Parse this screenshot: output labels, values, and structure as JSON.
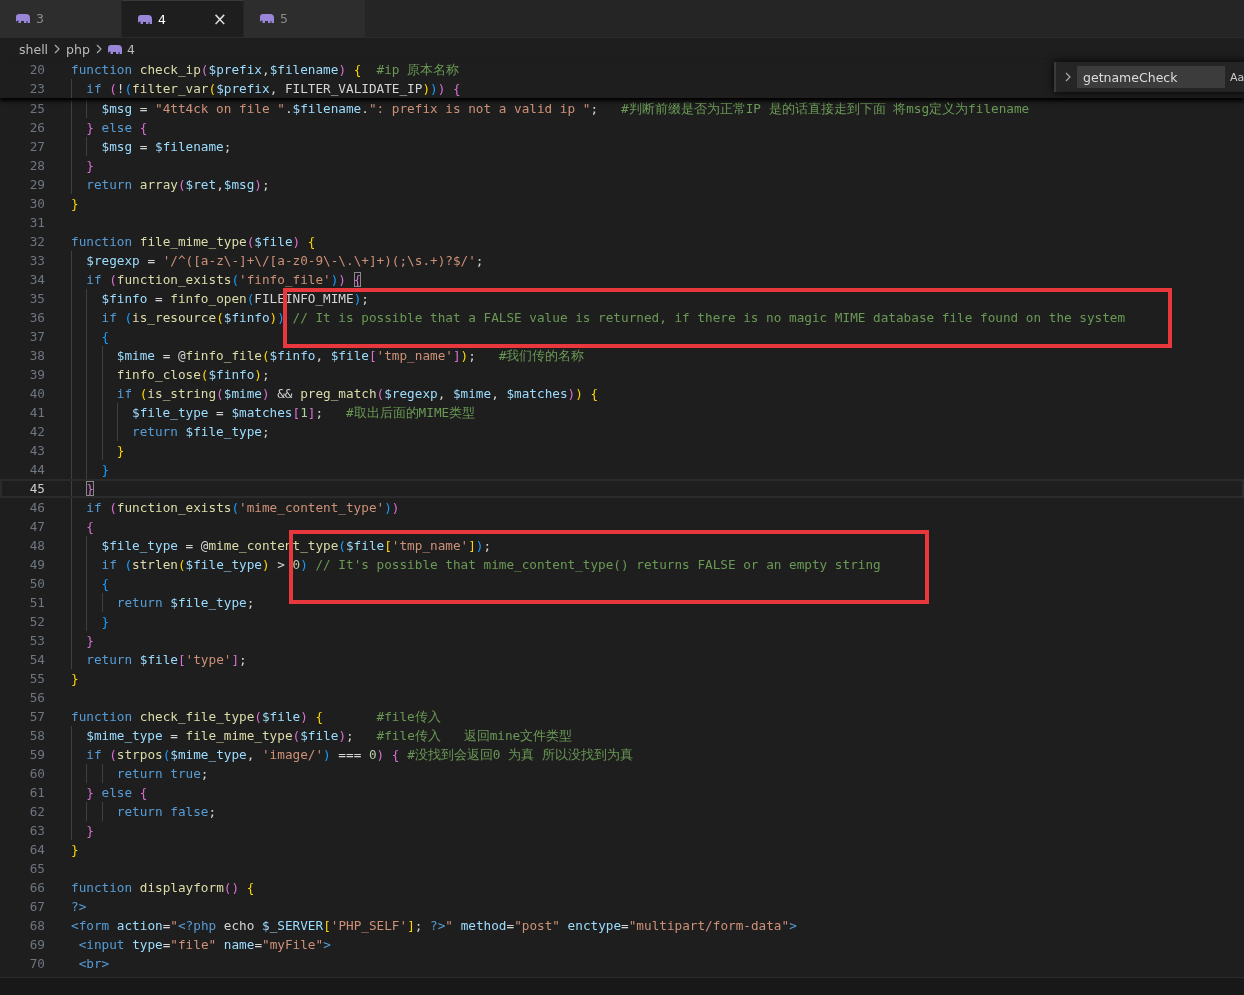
{
  "tabs": [
    {
      "label": "3",
      "selected": false,
      "closable": false
    },
    {
      "label": "4",
      "selected": true,
      "closable": true
    },
    {
      "label": "5",
      "selected": false,
      "closable": false
    }
  ],
  "close_glyph": "×",
  "breadcrumb": [
    "shell",
    "php",
    "4"
  ],
  "find": {
    "value": "getnameCheck",
    "toggle": "Aa"
  },
  "sticky_lines": [
    {
      "n": "20",
      "current": false,
      "tokens": [
        {
          "kind": "kw",
          "text": "function "
        },
        {
          "kind": "fn",
          "text": "check_ip"
        },
        {
          "kind": "b2",
          "text": "("
        },
        {
          "kind": "var",
          "text": "$prefix"
        },
        {
          "kind": "op",
          "text": ","
        },
        {
          "kind": "var",
          "text": "$filename"
        },
        {
          "kind": "b2",
          "text": ") "
        },
        {
          "kind": "b1",
          "text": "{  "
        },
        {
          "kind": "cm",
          "text": "#ip 原本名称"
        }
      ]
    },
    {
      "n": "23",
      "current": false,
      "tokens": [
        {
          "kind": "kw",
          "text": "  if "
        },
        {
          "kind": "b2",
          "text": "("
        },
        {
          "kind": "op",
          "text": "!"
        },
        {
          "kind": "b3",
          "text": "("
        },
        {
          "kind": "fn",
          "text": "filter_var"
        },
        {
          "kind": "b1",
          "text": "("
        },
        {
          "kind": "var",
          "text": "$prefix"
        },
        {
          "kind": "op",
          "text": ", FILTER_VALIDATE_IP"
        },
        {
          "kind": "b1",
          "text": ")"
        },
        {
          "kind": "b3",
          "text": ")"
        },
        {
          "kind": "b2",
          "text": ") {"
        }
      ]
    }
  ],
  "lines": [
    {
      "n": "25",
      "current": false,
      "tokens": [
        {
          "kind": "var",
          "text": "    $msg"
        },
        {
          "kind": "op",
          "text": " = "
        },
        {
          "kind": "str",
          "text": "\"4tt4ck on file \""
        },
        {
          "kind": "op",
          "text": "."
        },
        {
          "kind": "var",
          "text": "$filename"
        },
        {
          "kind": "op",
          "text": "."
        },
        {
          "kind": "str",
          "text": "\": prefix is not a valid ip \""
        },
        {
          "kind": "op",
          "text": ";   "
        },
        {
          "kind": "cm",
          "text": "#判断前缀是否为正常IP 是的话直接走到下面 将msg定义为filename"
        }
      ]
    },
    {
      "n": "26",
      "current": false,
      "tokens": [
        {
          "kind": "b2",
          "text": "  }"
        },
        {
          "kind": "kw",
          "text": " else "
        },
        {
          "kind": "b2",
          "text": "{"
        }
      ]
    },
    {
      "n": "27",
      "current": false,
      "tokens": [
        {
          "kind": "var",
          "text": "    $msg"
        },
        {
          "kind": "op",
          "text": " = "
        },
        {
          "kind": "var",
          "text": "$filename"
        },
        {
          "kind": "op",
          "text": ";"
        }
      ]
    },
    {
      "n": "28",
      "current": false,
      "tokens": [
        {
          "kind": "b2",
          "text": "  }"
        }
      ]
    },
    {
      "n": "29",
      "current": false,
      "tokens": [
        {
          "kind": "kw",
          "text": "  return "
        },
        {
          "kind": "fn",
          "text": "array"
        },
        {
          "kind": "b2",
          "text": "("
        },
        {
          "kind": "var",
          "text": "$ret"
        },
        {
          "kind": "op",
          "text": ","
        },
        {
          "kind": "var",
          "text": "$msg"
        },
        {
          "kind": "b2",
          "text": ")"
        },
        {
          "kind": "op",
          "text": ";"
        }
      ]
    },
    {
      "n": "30",
      "current": false,
      "tokens": [
        {
          "kind": "b1",
          "text": "}"
        }
      ]
    },
    {
      "n": "31",
      "current": false
    },
    {
      "n": "32",
      "current": false,
      "tokens": [
        {
          "kind": "kw",
          "text": "function "
        },
        {
          "kind": "fn",
          "text": "file_mime_type"
        },
        {
          "kind": "b2",
          "text": "("
        },
        {
          "kind": "var",
          "text": "$file"
        },
        {
          "kind": "b2",
          "text": ")"
        },
        {
          "kind": "b1",
          "text": " {"
        }
      ]
    },
    {
      "n": "33",
      "current": false,
      "tokens": [
        {
          "kind": "var",
          "text": "  $regexp"
        },
        {
          "kind": "op",
          "text": " = "
        },
        {
          "kind": "str",
          "text": "'/^([a-z\\-]+\\/[a-z0-9\\-\\.\\+]+)(;\\s.+)?$/'"
        },
        {
          "kind": "op",
          "text": ";"
        }
      ]
    },
    {
      "n": "34",
      "current": false,
      "tokens": [
        {
          "kind": "kw",
          "text": "  if "
        },
        {
          "kind": "b2",
          "text": "("
        },
        {
          "kind": "fn",
          "text": "function_exists"
        },
        {
          "kind": "b3",
          "text": "("
        },
        {
          "kind": "str",
          "text": "'finfo_file'"
        },
        {
          "kind": "b3",
          "text": ")"
        },
        {
          "kind": "b2",
          "text": ") "
        },
        {
          "kind": "b2m",
          "text": "{"
        }
      ]
    },
    {
      "n": "35",
      "current": false,
      "tokens": [
        {
          "kind": "var",
          "text": "    $finfo"
        },
        {
          "kind": "op",
          "text": " = "
        },
        {
          "kind": "fn",
          "text": "finfo_open"
        },
        {
          "kind": "b3",
          "text": "("
        },
        {
          "kind": "op",
          "text": "FILEINFO_MIME"
        },
        {
          "kind": "b3",
          "text": ")"
        },
        {
          "kind": "op",
          "text": ";"
        }
      ]
    },
    {
      "n": "36",
      "current": false,
      "tokens": [
        {
          "kind": "kw",
          "text": "    if "
        },
        {
          "kind": "b3",
          "text": "("
        },
        {
          "kind": "fn",
          "text": "is_resource"
        },
        {
          "kind": "b1",
          "text": "("
        },
        {
          "kind": "var",
          "text": "$finfo"
        },
        {
          "kind": "b1",
          "text": ")"
        },
        {
          "kind": "b3",
          "text": ") "
        },
        {
          "kind": "cm",
          "text": "// It is possible that a FALSE value is returned, if there is no magic MIME database file found on the system"
        }
      ]
    },
    {
      "n": "37",
      "current": false,
      "tokens": [
        {
          "kind": "b3",
          "text": "    {"
        }
      ]
    },
    {
      "n": "38",
      "current": false,
      "tokens": [
        {
          "kind": "var",
          "text": "      $mime"
        },
        {
          "kind": "op",
          "text": " = @"
        },
        {
          "kind": "fn",
          "text": "finfo_file"
        },
        {
          "kind": "b1",
          "text": "("
        },
        {
          "kind": "var",
          "text": "$finfo"
        },
        {
          "kind": "op",
          "text": ", "
        },
        {
          "kind": "var",
          "text": "$file"
        },
        {
          "kind": "b2",
          "text": "["
        },
        {
          "kind": "str",
          "text": "'tmp_name'"
        },
        {
          "kind": "b2",
          "text": "]"
        },
        {
          "kind": "b1",
          "text": ")"
        },
        {
          "kind": "op",
          "text": ";   "
        },
        {
          "kind": "cm",
          "text": "#我们传的名称"
        }
      ]
    },
    {
      "n": "39",
      "current": false,
      "tokens": [
        {
          "kind": "fn",
          "text": "      finfo_close"
        },
        {
          "kind": "b1",
          "text": "("
        },
        {
          "kind": "var",
          "text": "$finfo"
        },
        {
          "kind": "b1",
          "text": ")"
        },
        {
          "kind": "op",
          "text": ";"
        }
      ]
    },
    {
      "n": "40",
      "current": false,
      "tokens": [
        {
          "kind": "kw",
          "text": "      if "
        },
        {
          "kind": "b1",
          "text": "("
        },
        {
          "kind": "fn",
          "text": "is_string"
        },
        {
          "kind": "b2",
          "text": "("
        },
        {
          "kind": "var",
          "text": "$mime"
        },
        {
          "kind": "b2",
          "text": ")"
        },
        {
          "kind": "op",
          "text": " && "
        },
        {
          "kind": "fn",
          "text": "preg_match"
        },
        {
          "kind": "b2",
          "text": "("
        },
        {
          "kind": "var",
          "text": "$regexp"
        },
        {
          "kind": "op",
          "text": ", "
        },
        {
          "kind": "var",
          "text": "$mime"
        },
        {
          "kind": "op",
          "text": ", "
        },
        {
          "kind": "var",
          "text": "$matches"
        },
        {
          "kind": "b2",
          "text": ")"
        },
        {
          "kind": "b1",
          "text": ") {"
        }
      ]
    },
    {
      "n": "41",
      "current": false,
      "tokens": [
        {
          "kind": "var",
          "text": "        $file_type"
        },
        {
          "kind": "op",
          "text": " = "
        },
        {
          "kind": "var",
          "text": "$matches"
        },
        {
          "kind": "b2",
          "text": "["
        },
        {
          "kind": "num",
          "text": "1"
        },
        {
          "kind": "b2",
          "text": "]"
        },
        {
          "kind": "op",
          "text": ";   "
        },
        {
          "kind": "cm",
          "text": "#取出后面的MIME类型"
        }
      ]
    },
    {
      "n": "42",
      "current": false,
      "tokens": [
        {
          "kind": "kw",
          "text": "        return "
        },
        {
          "kind": "var",
          "text": "$file_type"
        },
        {
          "kind": "op",
          "text": ";"
        }
      ]
    },
    {
      "n": "43",
      "current": false,
      "tokens": [
        {
          "kind": "b1",
          "text": "      }"
        }
      ]
    },
    {
      "n": "44",
      "current": false,
      "tokens": [
        {
          "kind": "b3",
          "text": "    }"
        }
      ]
    },
    {
      "n": "45",
      "current": true,
      "tokens": [
        {
          "kind": "b2m",
          "text": "  }"
        }
      ]
    },
    {
      "n": "46",
      "current": false,
      "tokens": [
        {
          "kind": "kw",
          "text": "  if "
        },
        {
          "kind": "b2",
          "text": "("
        },
        {
          "kind": "fn",
          "text": "function_exists"
        },
        {
          "kind": "b3",
          "text": "("
        },
        {
          "kind": "str",
          "text": "'mime_content_type'"
        },
        {
          "kind": "b3",
          "text": ")"
        },
        {
          "kind": "b2",
          "text": ")"
        }
      ]
    },
    {
      "n": "47",
      "current": false,
      "tokens": [
        {
          "kind": "b2",
          "text": "  {"
        }
      ]
    },
    {
      "n": "48",
      "current": false,
      "tokens": [
        {
          "kind": "var",
          "text": "    $file_type"
        },
        {
          "kind": "op",
          "text": " = @"
        },
        {
          "kind": "fn",
          "text": "mime_content_type"
        },
        {
          "kind": "b3",
          "text": "("
        },
        {
          "kind": "var",
          "text": "$file"
        },
        {
          "kind": "b1",
          "text": "["
        },
        {
          "kind": "str",
          "text": "'tmp_name'"
        },
        {
          "kind": "b1",
          "text": "]"
        },
        {
          "kind": "b3",
          "text": ")"
        },
        {
          "kind": "op",
          "text": ";"
        }
      ]
    },
    {
      "n": "49",
      "current": false,
      "tokens": [
        {
          "kind": "kw",
          "text": "    if "
        },
        {
          "kind": "b3",
          "text": "("
        },
        {
          "kind": "fn",
          "text": "strlen"
        },
        {
          "kind": "b1",
          "text": "("
        },
        {
          "kind": "var",
          "text": "$file_type"
        },
        {
          "kind": "b1",
          "text": ")"
        },
        {
          "kind": "op",
          "text": " > "
        },
        {
          "kind": "num",
          "text": "0"
        },
        {
          "kind": "b3",
          "text": ") "
        },
        {
          "kind": "cm",
          "text": "// It's possible that mime_content_type() returns FALSE or an empty string"
        }
      ]
    },
    {
      "n": "50",
      "current": false,
      "tokens": [
        {
          "kind": "b3",
          "text": "    {"
        }
      ]
    },
    {
      "n": "51",
      "current": false,
      "tokens": [
        {
          "kind": "kw",
          "text": "      return "
        },
        {
          "kind": "var",
          "text": "$file_type"
        },
        {
          "kind": "op",
          "text": ";"
        }
      ]
    },
    {
      "n": "52",
      "current": false,
      "tokens": [
        {
          "kind": "b3",
          "text": "    }"
        }
      ]
    },
    {
      "n": "53",
      "current": false,
      "tokens": [
        {
          "kind": "b2",
          "text": "  }"
        }
      ]
    },
    {
      "n": "54",
      "current": false,
      "tokens": [
        {
          "kind": "kw",
          "text": "  return "
        },
        {
          "kind": "var",
          "text": "$file"
        },
        {
          "kind": "b2",
          "text": "["
        },
        {
          "kind": "str",
          "text": "'type'"
        },
        {
          "kind": "b2",
          "text": "]"
        },
        {
          "kind": "op",
          "text": ";"
        }
      ]
    },
    {
      "n": "55",
      "current": false,
      "tokens": [
        {
          "kind": "b1",
          "text": "}"
        }
      ]
    },
    {
      "n": "56",
      "current": false
    },
    {
      "n": "57",
      "current": false,
      "tokens": [
        {
          "kind": "kw",
          "text": "function "
        },
        {
          "kind": "fn",
          "text": "check_file_type"
        },
        {
          "kind": "b2",
          "text": "("
        },
        {
          "kind": "var",
          "text": "$file"
        },
        {
          "kind": "b2",
          "text": ")"
        },
        {
          "kind": "b1",
          "text": " {       "
        },
        {
          "kind": "cm",
          "text": "#file传入"
        }
      ]
    },
    {
      "n": "58",
      "current": false,
      "tokens": [
        {
          "kind": "var",
          "text": "  $mime_type"
        },
        {
          "kind": "op",
          "text": " = "
        },
        {
          "kind": "fn",
          "text": "file_mime_type"
        },
        {
          "kind": "b2",
          "text": "("
        },
        {
          "kind": "var",
          "text": "$file"
        },
        {
          "kind": "b2",
          "text": ")"
        },
        {
          "kind": "op",
          "text": ";   "
        },
        {
          "kind": "cm",
          "text": "#file传入   返回mine文件类型"
        }
      ]
    },
    {
      "n": "59",
      "current": false,
      "tokens": [
        {
          "kind": "kw",
          "text": "  if "
        },
        {
          "kind": "b2",
          "text": "("
        },
        {
          "kind": "fn",
          "text": "strpos"
        },
        {
          "kind": "b3",
          "text": "("
        },
        {
          "kind": "var",
          "text": "$mime_type"
        },
        {
          "kind": "op",
          "text": ", "
        },
        {
          "kind": "str",
          "text": "'image/'"
        },
        {
          "kind": "b3",
          "text": ")"
        },
        {
          "kind": "op",
          "text": " === "
        },
        {
          "kind": "num",
          "text": "0"
        },
        {
          "kind": "b2",
          "text": ") { "
        },
        {
          "kind": "cm",
          "text": "#没找到会返回0 为真 所以没找到为真"
        }
      ]
    },
    {
      "n": "60",
      "current": false,
      "tokens": [
        {
          "kind": "kw",
          "text": "      return true"
        },
        {
          "kind": "op",
          "text": ";"
        }
      ]
    },
    {
      "n": "61",
      "current": false,
      "tokens": [
        {
          "kind": "b2",
          "text": "  }"
        },
        {
          "kind": "kw",
          "text": " else "
        },
        {
          "kind": "b2",
          "text": "{"
        }
      ]
    },
    {
      "n": "62",
      "current": false,
      "tokens": [
        {
          "kind": "kw",
          "text": "      return false"
        },
        {
          "kind": "op",
          "text": ";"
        }
      ]
    },
    {
      "n": "63",
      "current": false,
      "tokens": [
        {
          "kind": "b2",
          "text": "  }"
        }
      ]
    },
    {
      "n": "64",
      "current": false,
      "tokens": [
        {
          "kind": "b1",
          "text": "}"
        }
      ]
    },
    {
      "n": "65",
      "current": false
    },
    {
      "n": "66",
      "current": false,
      "tokens": [
        {
          "kind": "kw",
          "text": "function "
        },
        {
          "kind": "fn",
          "text": "displayform"
        },
        {
          "kind": "b2",
          "text": "()"
        },
        {
          "kind": "b1",
          "text": " {"
        }
      ]
    },
    {
      "n": "67",
      "current": false,
      "tokens": [
        {
          "kind": "kw",
          "text": "?>"
        }
      ]
    },
    {
      "n": "68",
      "current": false,
      "tokens": [
        {
          "kind": "tag",
          "text": "<form "
        },
        {
          "kind": "attr",
          "text": "action"
        },
        {
          "kind": "op",
          "text": "="
        },
        {
          "kind": "str",
          "text": "\""
        },
        {
          "kind": "kw",
          "text": "<?php "
        },
        {
          "kind": "op",
          "text": "echo "
        },
        {
          "kind": "var",
          "text": "$_SERVER"
        },
        {
          "kind": "b1",
          "text": "["
        },
        {
          "kind": "str",
          "text": "'PHP_SELF'"
        },
        {
          "kind": "b1",
          "text": "]"
        },
        {
          "kind": "op",
          "text": "; "
        },
        {
          "kind": "kw",
          "text": "?>"
        },
        {
          "kind": "str",
          "text": "\""
        },
        {
          "kind": "attr",
          "text": " method"
        },
        {
          "kind": "op",
          "text": "="
        },
        {
          "kind": "str",
          "text": "\"post\""
        },
        {
          "kind": "attr",
          "text": " enctype"
        },
        {
          "kind": "op",
          "text": "="
        },
        {
          "kind": "str",
          "text": "\"multipart/form-data\""
        },
        {
          "kind": "tag",
          "text": ">"
        }
      ]
    },
    {
      "n": "69",
      "current": false,
      "tokens": [
        {
          "kind": "tag",
          "text": " <input "
        },
        {
          "kind": "attr",
          "text": "type"
        },
        {
          "kind": "op",
          "text": "="
        },
        {
          "kind": "str",
          "text": "\"file\""
        },
        {
          "kind": "attr",
          "text": " name"
        },
        {
          "kind": "op",
          "text": "="
        },
        {
          "kind": "str",
          "text": "\"myFile\""
        },
        {
          "kind": "tag",
          "text": ">"
        }
      ]
    },
    {
      "n": "70",
      "current": false,
      "tokens": [
        {
          "kind": "tag",
          "text": " <br>"
        }
      ]
    }
  ],
  "annotations": [
    {
      "kind": "rectangle"
    },
    {
      "kind": "rectangle"
    }
  ]
}
